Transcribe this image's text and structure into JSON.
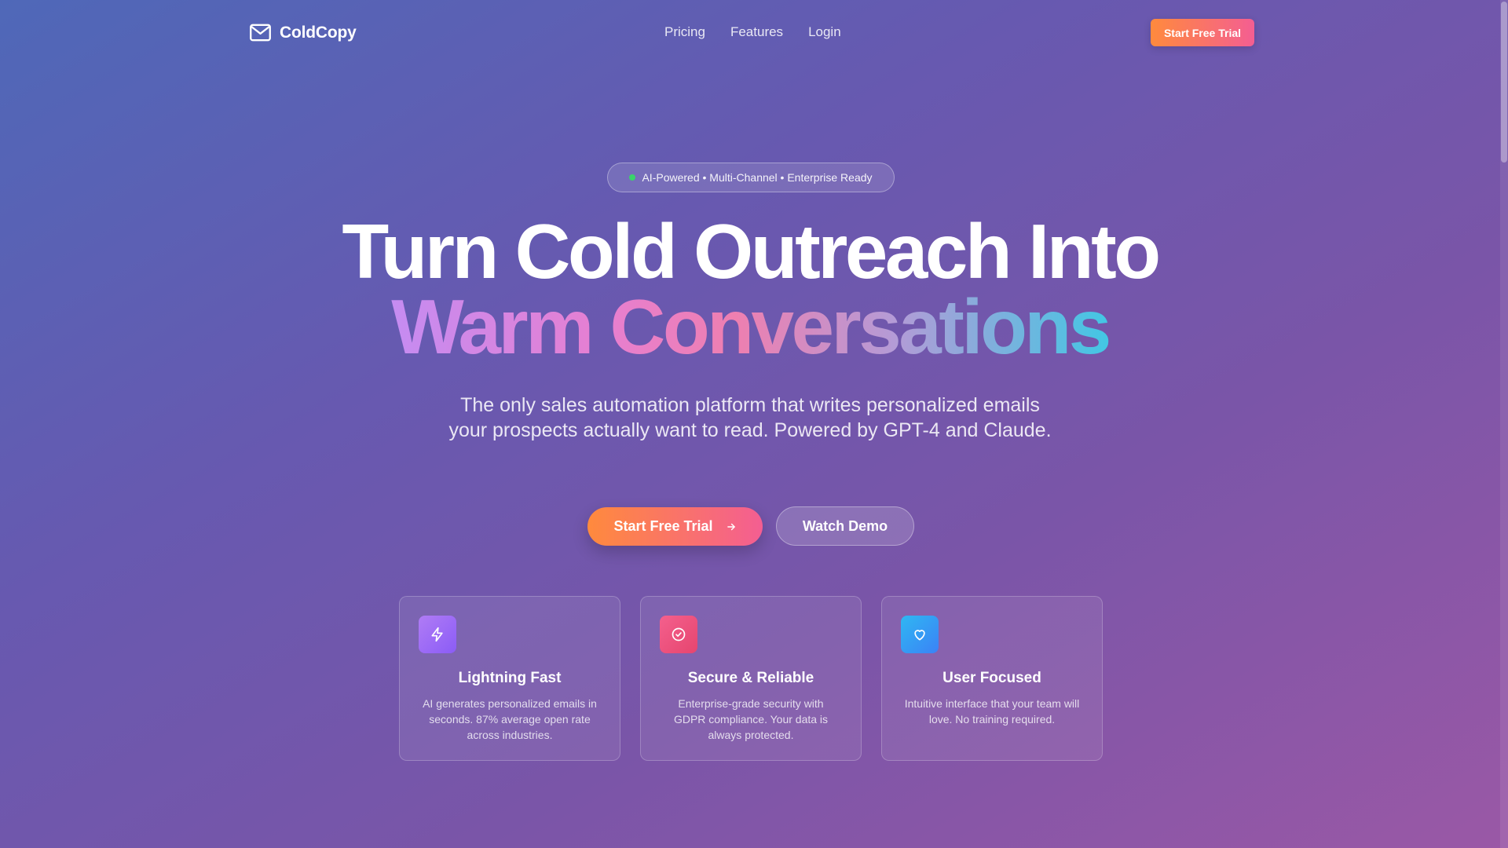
{
  "header": {
    "logo_text": "ColdCopy",
    "nav": [
      "Pricing",
      "Features",
      "Login"
    ],
    "cta_label": "Start Free Trial"
  },
  "hero": {
    "badge": "AI-Powered • Multi-Channel • Enterprise Ready",
    "headline_line1": "Turn Cold Outreach Into",
    "headline_line2": "Warm Conversations",
    "subtitle": "The only sales automation platform that writes personalized emails your prospects actually want to read. Powered by GPT-4 and Claude.",
    "primary_cta": "Start Free Trial",
    "secondary_cta": "Watch Demo"
  },
  "features": [
    {
      "icon": "lightning-icon",
      "title": "Lightning Fast",
      "description": "AI generates personalized emails in seconds. 87% average open rate across industries.",
      "icon_colors": [
        "#b07cf5",
        "#8b5cf6"
      ]
    },
    {
      "icon": "check-circle-icon",
      "title": "Secure & Reliable",
      "description": "Enterprise-grade security with GDPR compliance. Your data is always protected.",
      "icon_colors": [
        "#f4608d",
        "#e6456f"
      ]
    },
    {
      "icon": "heart-icon",
      "title": "User Focused",
      "description": "Intuitive interface that your team will love. No training required.",
      "icon_colors": [
        "#2fb7f2",
        "#3b82f6"
      ]
    }
  ],
  "colors": {
    "cta_gradient_start": "#ff8a3d",
    "cta_gradient_end": "#f45e92",
    "badge_dot": "#39d46a"
  }
}
